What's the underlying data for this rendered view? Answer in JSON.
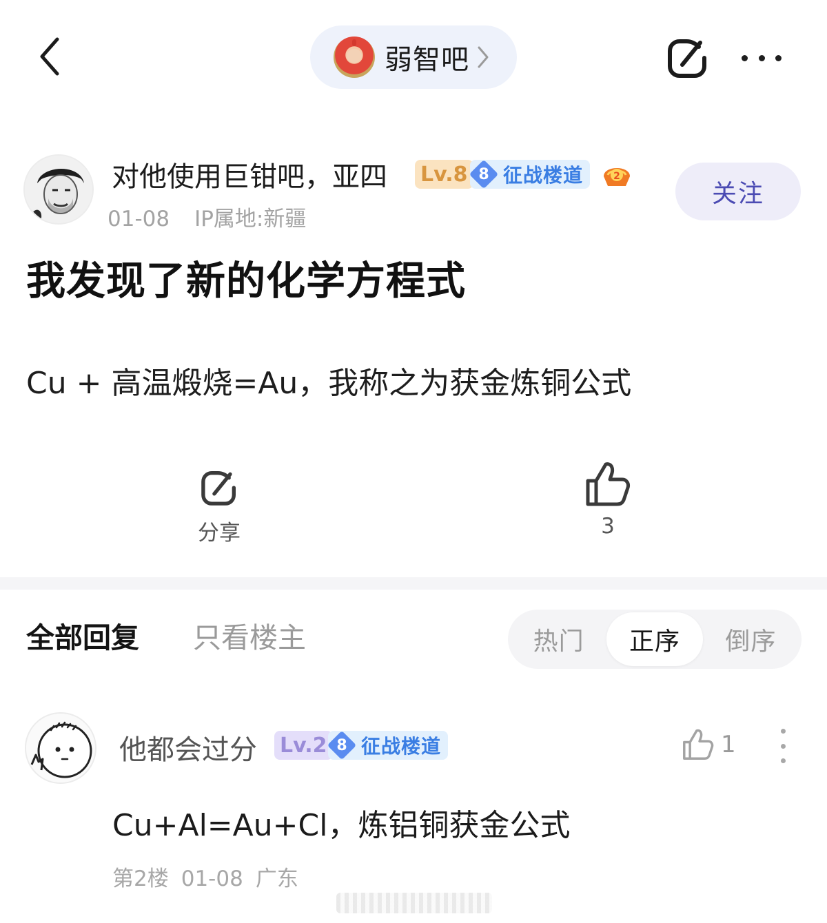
{
  "nav": {
    "forum_name": "弱智吧",
    "icons": {
      "back": "chevron-left-icon",
      "forum_chevron": "chevron-right-icon",
      "share": "share-icon",
      "more": "more-horizontal-icon"
    }
  },
  "post": {
    "author": {
      "name": "对他使用巨钳吧，亚四",
      "level": "Lv.8",
      "rank_number": "8",
      "rank_title": "征战楼道",
      "medal_icon": "medal-2-icon",
      "date": "01-08",
      "ip_location": "IP属地:新疆"
    },
    "follow_label": "关注",
    "title": "我发现了新的化学方程式",
    "body": "Cu + 高温煅烧=Au，我称之为获金炼铜公式",
    "actions": {
      "share_label": "分享",
      "like_count": "3"
    }
  },
  "replies_section": {
    "tabs": {
      "all": "全部回复",
      "op_only": "只看楼主"
    },
    "sort_options": [
      "热门",
      "正序",
      "倒序"
    ],
    "active_sort": "正序"
  },
  "replies": [
    {
      "name": "他都会过分",
      "level": "Lv.2",
      "rank_number": "8",
      "rank_title": "征战楼道",
      "like_count": "1",
      "body": "Cu+Al=Au+Cl，炼铝铜获金公式",
      "floor": "第2楼",
      "date": "01-08",
      "location": "广东"
    }
  ],
  "colors": {
    "accent": "#4b4bb3",
    "forum_pill_bg": "#eef2fb",
    "level8_bg": "#fbe3c0",
    "level8_fg": "#d8953f",
    "level2_bg": "#e4defa",
    "level2_fg": "#9a8cd8",
    "rank_fg": "#3a7ee3"
  }
}
